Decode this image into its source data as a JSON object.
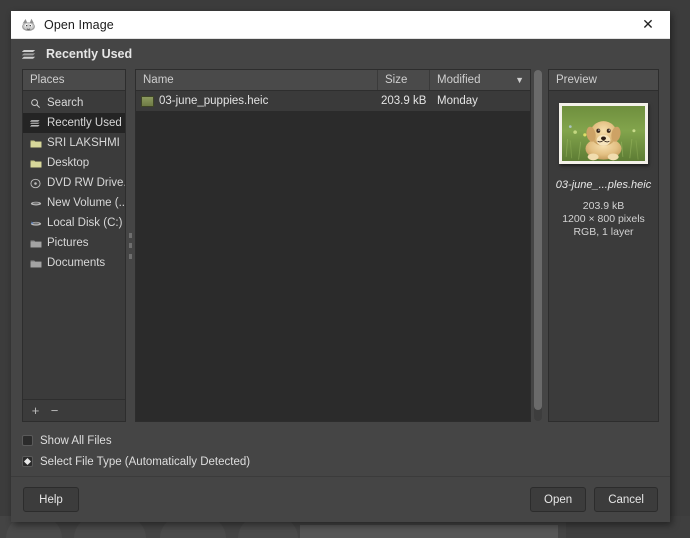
{
  "window": {
    "title": "Open Image",
    "icon": "gimp-wilber-icon",
    "close_label": "✕"
  },
  "location": {
    "icon": "recently-used-stack-icon",
    "title": "Recently Used"
  },
  "places": {
    "header": "Places",
    "items": [
      {
        "label": "Search",
        "icon": "search-icon",
        "selected": false
      },
      {
        "label": "Recently Used",
        "icon": "recent-stack-icon",
        "selected": true
      },
      {
        "label": "SRI LAKSHMI",
        "icon": "folder-icon",
        "selected": false
      },
      {
        "label": "Desktop",
        "icon": "folder-icon",
        "selected": false
      },
      {
        "label": "DVD RW Drive...",
        "icon": "optical-disc-icon",
        "selected": false
      },
      {
        "label": "New Volume (...",
        "icon": "drive-icon",
        "selected": false
      },
      {
        "label": "Local Disk (C:)",
        "icon": "hard-disk-icon",
        "selected": false
      },
      {
        "label": "Pictures",
        "icon": "folder-gray-icon",
        "selected": false
      },
      {
        "label": "Documents",
        "icon": "folder-gray-icon",
        "selected": false
      }
    ],
    "add_label": "+",
    "remove_label": "−"
  },
  "file_list": {
    "columns": {
      "name": "Name",
      "size": "Size",
      "modified": "Modified"
    },
    "sort_indicator": "chevron-down-icon",
    "rows": [
      {
        "name": "03-june_puppies.heic",
        "size": "203.9 kB",
        "modified": "Monday",
        "icon": "image-thumb-icon",
        "selected": true
      }
    ]
  },
  "preview": {
    "header": "Preview",
    "thumbnail_alt": "golden-retriever-puppy-in-grass",
    "file_name": "03-june_...ples.heic",
    "file_size": "203.9 kB",
    "dimensions": "1200 × 800 pixels",
    "color_info": "RGB, 1 layer"
  },
  "options": {
    "show_all_files": "Show All Files",
    "show_all_files_checked": false,
    "select_file_type": "Select File Type (Automatically Detected)"
  },
  "footer": {
    "help": "Help",
    "open": "Open",
    "cancel": "Cancel"
  },
  "colors": {
    "dialog_bg": "#454545",
    "panel_bg": "#3b3b3b",
    "list_bg": "#2b2b2b",
    "header_bg": "#4a4a4a",
    "selection_bg": "#242424",
    "titlebar_bg": "#ffffff",
    "text": "#e0e0e0"
  }
}
